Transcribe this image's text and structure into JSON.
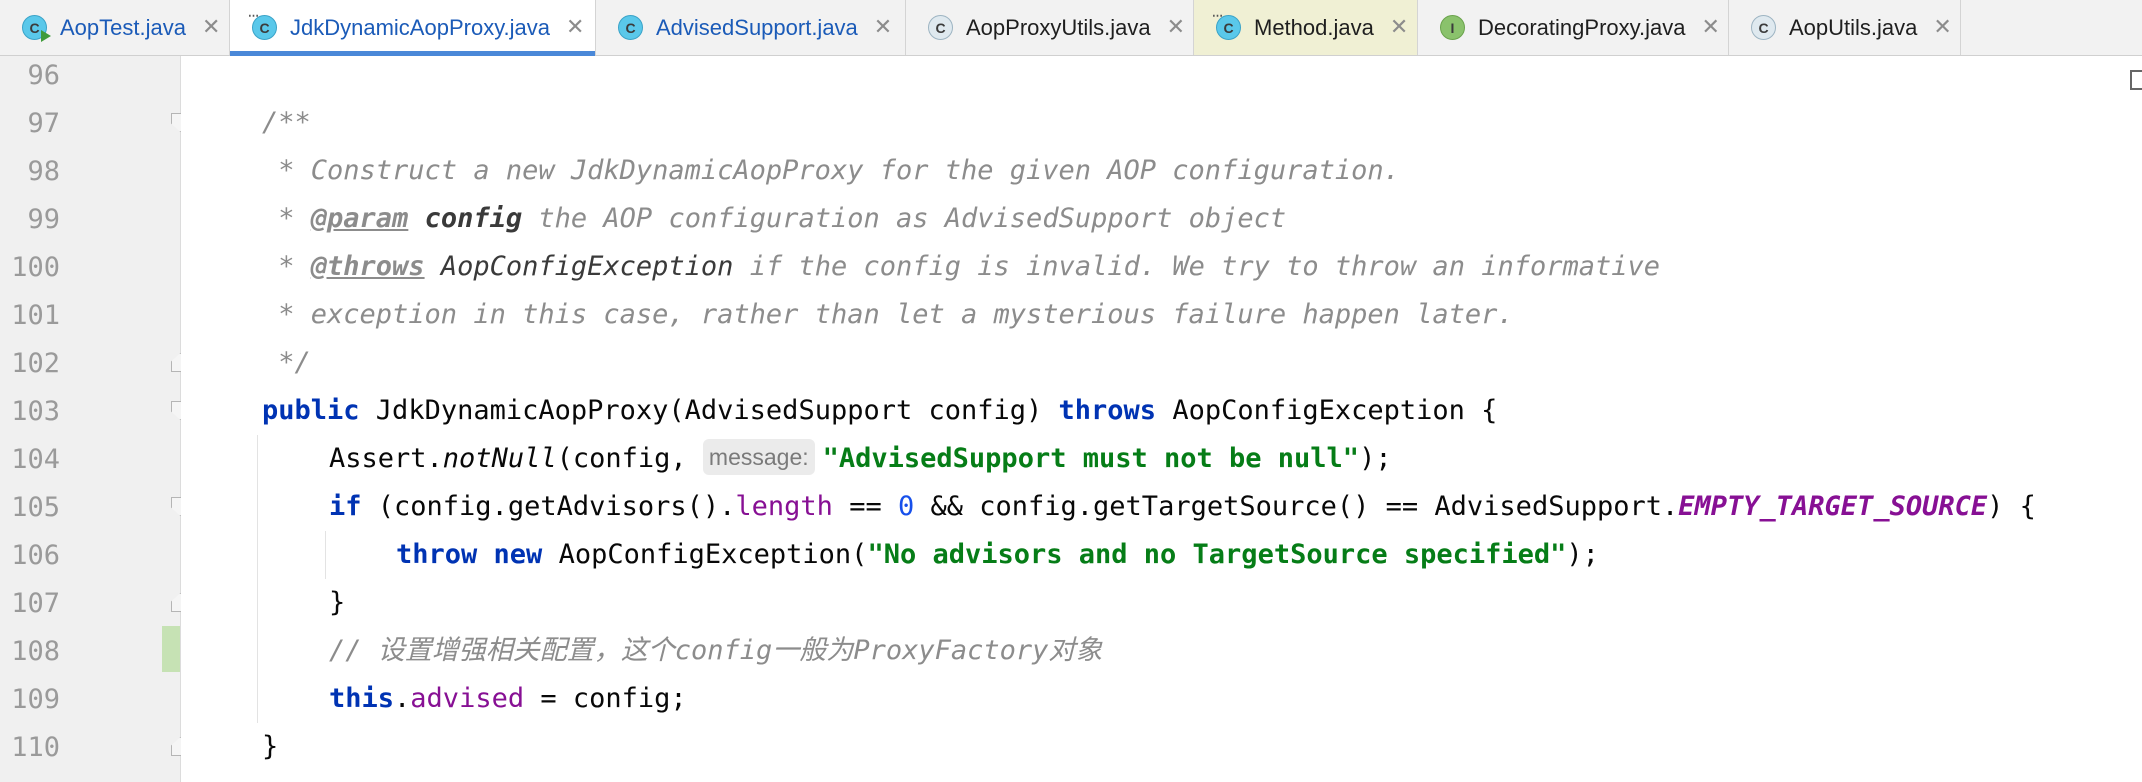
{
  "tabs": [
    {
      "label": "AopTest.java",
      "icon": "java-test-class-icon",
      "modified": true,
      "active": false
    },
    {
      "label": "JdkDynamicAopProxy.java",
      "icon": "java-class-icon",
      "modified": true,
      "active": true
    },
    {
      "label": "AdvisedSupport.java",
      "icon": "java-class-icon",
      "modified": true,
      "active": false
    },
    {
      "label": "AopProxyUtils.java",
      "icon": "java-abstract-class-icon",
      "modified": false,
      "active": false
    },
    {
      "label": "Method.java",
      "icon": "java-class-icon",
      "modified": false,
      "active": false,
      "highlighted": true
    },
    {
      "label": "DecoratingProxy.java",
      "icon": "java-interface-icon",
      "modified": false,
      "active": false
    },
    {
      "label": "AopUtils.java",
      "icon": "java-abstract-class-icon",
      "modified": false,
      "active": false
    }
  ],
  "close_glyph": "✕",
  "line_numbers": [
    "96",
    "97",
    "98",
    "99",
    "100",
    "101",
    "102",
    "103",
    "104",
    "105",
    "106",
    "107",
    "108",
    "109",
    "110"
  ],
  "code": {
    "l97": "/**",
    "l98": " * Construct a new JdkDynamicAopProxy for the given AOP configuration.",
    "l99_star": " * ",
    "l99_tag": "@param",
    "l99_name": "config",
    "l99_rest": " the AOP configuration as AdvisedSupport object",
    "l100_star": " * ",
    "l100_tag": "@throws",
    "l100_ref": "AopConfigException",
    "l100_rest": " if the config is invalid. We try to throw an informative",
    "l101": " * exception in this case, rather than let a mysterious failure happen later.",
    "l102": " */",
    "l103_kw1": "public",
    "l103_mid": " JdkDynamicAopProxy(AdvisedSupport config) ",
    "l103_kw2": "throws",
    "l103_end": " AopConfigException {",
    "l104_pre": "Assert.",
    "l104_method": "notNull",
    "l104_args": "(config, ",
    "l104_hint": "message:",
    "l104_str": "\"AdvisedSupport must not be null\"",
    "l104_end": ");",
    "l105_kw": "if",
    "l105_a": " (config.getAdvisors().",
    "l105_field": "length",
    "l105_b": " == ",
    "l105_num": "0",
    "l105_c": " && config.getTargetSource() == AdvisedSupport.",
    "l105_static": "EMPTY_TARGET_SOURCE",
    "l105_end": ") {",
    "l106_kw1": "throw",
    "l106_kw2": "new",
    "l106_mid": " AopConfigException(",
    "l106_str": "\"No advisors and no TargetSource specified\"",
    "l106_end": ");",
    "l107": "}",
    "l108_a": "// 设置增强相关配置，这个",
    "l108_b": "config",
    "l108_c": "一般为",
    "l108_d": "ProxyFactory",
    "l108_e": "对象",
    "l109_kw": "this",
    "l109_dot": ".",
    "l109_field": "advised",
    "l109_end": " = config;",
    "l110": "}"
  }
}
